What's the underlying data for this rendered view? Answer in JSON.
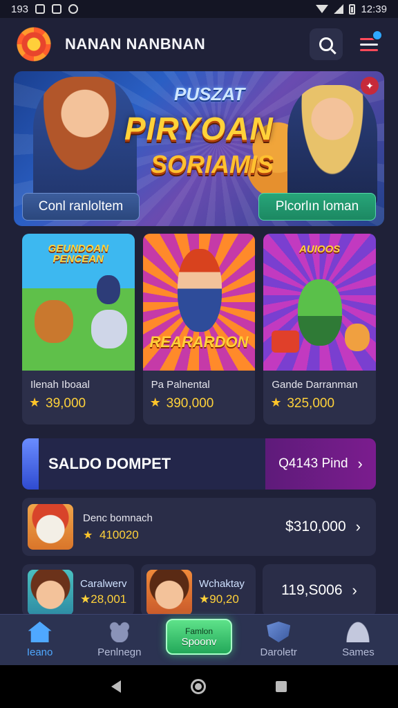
{
  "status_bar": {
    "time_left": "193",
    "time_right": "12:39"
  },
  "app": {
    "title": "NANAN NANBNAN"
  },
  "banner": {
    "kicker": "PUSZAT",
    "title": "PIRYOAN",
    "subtitle": "SORIAMIS",
    "left_button": "Conl ranloltem",
    "right_button": "Plcorlın loman"
  },
  "games": [
    {
      "art_title": "GEUNDOAN PENCEAN",
      "name": "Ilenah Iboaal",
      "score": "39,000"
    },
    {
      "art_title": "REARARDON",
      "name": "Pa Palnental",
      "score": "390,000"
    },
    {
      "art_title": "AUIOOS",
      "name": "Gande Darranman",
      "score": "325,000"
    }
  ],
  "wallet": {
    "label": "SALDO DOMPET",
    "value": "Q4143 Pind"
  },
  "list_row": {
    "title": "Denc bomnach",
    "score": "410020",
    "amount": "$310,000"
  },
  "mini_cards": [
    {
      "title": "Caralwerv",
      "score": "28,001"
    },
    {
      "title": "Wchaktay",
      "score": "90,20"
    },
    {
      "amount": "119,S006"
    }
  ],
  "tabs": [
    {
      "label": "Ieano",
      "icon": "home-icon",
      "active": true
    },
    {
      "label": "Penlnegn",
      "icon": "pet-icon"
    },
    {
      "center_top": "Famlon",
      "center_bottom": "Spoonv"
    },
    {
      "label": "Daroletr",
      "icon": "shield-icon"
    },
    {
      "label": "Sames",
      "icon": "user-icon"
    }
  ],
  "colors": {
    "accent": "#4fa8ff",
    "gold": "#ffd23a",
    "wallet_purple": "#7b1c8e",
    "primary_green": "#27a579"
  }
}
